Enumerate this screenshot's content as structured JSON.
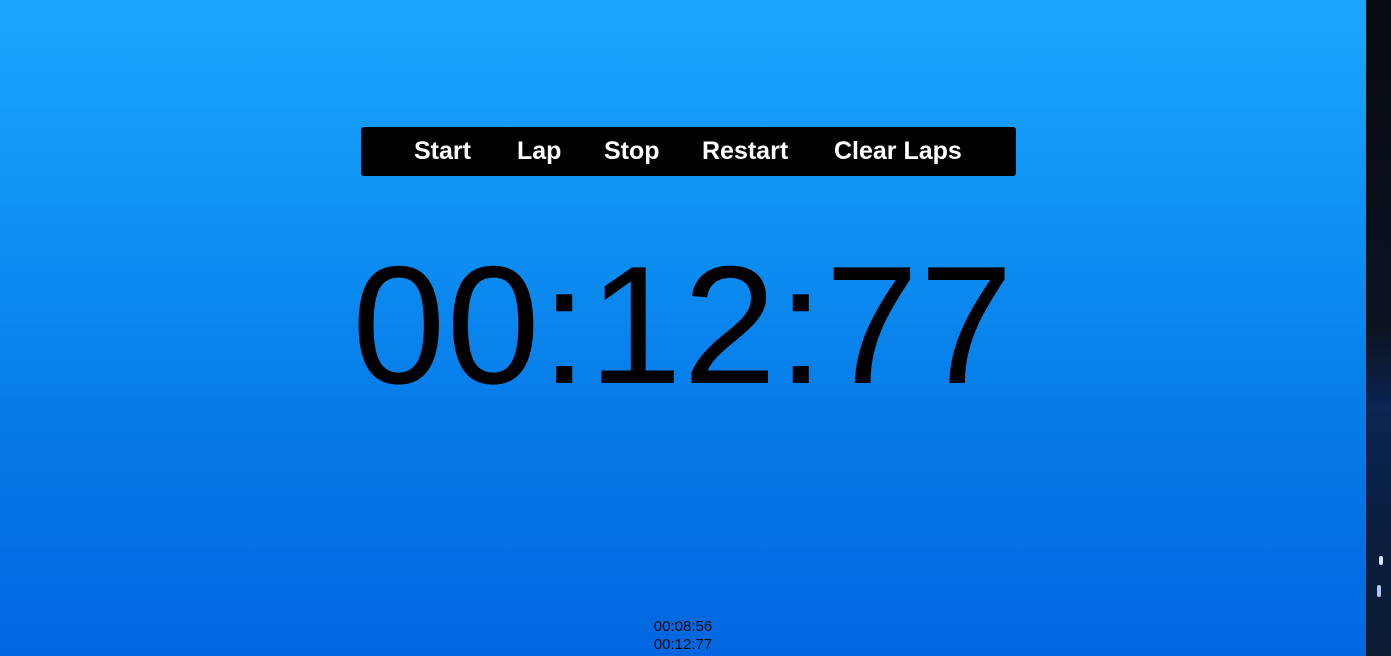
{
  "controls": {
    "start_label": "Start",
    "lap_label": "Lap",
    "stop_label": "Stop",
    "restart_label": "Restart",
    "clear_laps_label": "Clear Laps"
  },
  "timer": {
    "display": "00:12:77"
  },
  "laps": [
    "00:08:56",
    "00:12:77"
  ],
  "colors": {
    "background_top": "#1aa8ff",
    "background_bottom": "#0266e0",
    "toolbar": "#000000",
    "button_text": "#ffffff",
    "timer_text": "#000000"
  }
}
